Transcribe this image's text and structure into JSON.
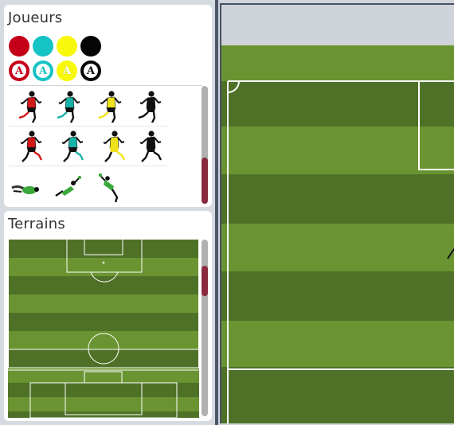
{
  "players_panel": {
    "title": "Joueurs",
    "color_swatches": [
      {
        "name": "red",
        "color": "#c40018"
      },
      {
        "name": "teal",
        "color": "#14c3c3"
      },
      {
        "name": "yellow",
        "color": "#f8f80a"
      },
      {
        "name": "black",
        "color": "#050505"
      }
    ],
    "letter_markers": [
      {
        "letter": "A",
        "color": "#c40018"
      },
      {
        "letter": "A",
        "color": "#14c3c3"
      },
      {
        "letter": "A",
        "color": "#f8f80a"
      },
      {
        "letter": "A",
        "color": "#050505"
      }
    ],
    "player_sprites": [
      {
        "team": "red",
        "pose": "run",
        "shirt": "#d01818",
        "shorts": "#111111"
      },
      {
        "team": "teal",
        "pose": "run",
        "shirt": "#18b3a8",
        "shorts": "#111111"
      },
      {
        "team": "yellow",
        "pose": "run",
        "shirt": "#f0e21a",
        "shorts": "#111111"
      },
      {
        "team": "black",
        "pose": "run",
        "shirt": "#111111",
        "shorts": "#111111"
      },
      {
        "team": "red",
        "pose": "kick",
        "shirt": "#d01818",
        "shorts": "#111111"
      },
      {
        "team": "teal",
        "pose": "kick",
        "shirt": "#18b3a8",
        "shorts": "#111111"
      },
      {
        "team": "yellow",
        "pose": "kick",
        "shirt": "#f0e21a",
        "shorts": "#f0e21a"
      },
      {
        "team": "black",
        "pose": "kick",
        "shirt": "#111111",
        "shorts": "#111111"
      }
    ],
    "goalkeeper_sprites": [
      {
        "pose": "dive-low",
        "shirt": "#3aa83a"
      },
      {
        "pose": "dive-mid",
        "shirt": "#3aa83a"
      },
      {
        "pose": "dive-high",
        "shirt": "#3aa83a"
      }
    ]
  },
  "terrains_panel": {
    "title": "Terrains",
    "thumbnails": [
      {
        "name": "half-field-vertical"
      },
      {
        "name": "penalty-area-horizontal"
      }
    ]
  },
  "colors": {
    "grass_light": "#6a9432",
    "grass_dark": "#4e7127",
    "line": "#ffffff",
    "scroll_thumb": "#8b2a3f",
    "panel_bg": "#ffffff",
    "app_bg": "#d6dbe1"
  }
}
